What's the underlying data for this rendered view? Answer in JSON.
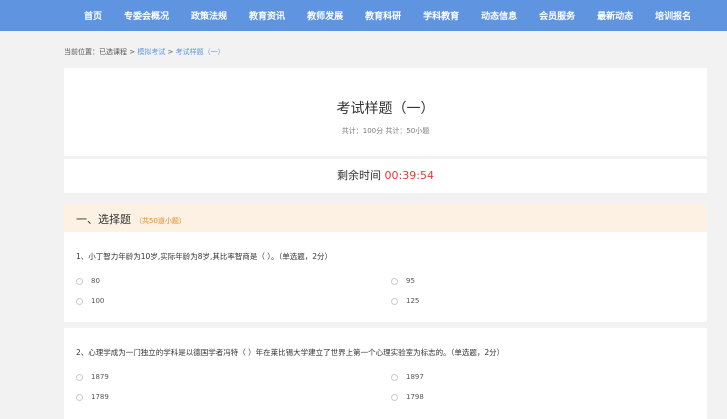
{
  "nav": {
    "items": [
      "首页",
      "专委会概况",
      "政策法规",
      "教育资讯",
      "教师发展",
      "教育科研",
      "学科教育",
      "动态信息",
      "会员服务",
      "最新动态",
      "培训报名"
    ]
  },
  "breadcrumb": {
    "prefix": "当前位置：",
    "items": [
      "已选课程",
      "模拟考试",
      "考试样题（一）"
    ],
    "separator": " > "
  },
  "exam": {
    "title": "考试样题（一）",
    "meta": "共计：100分 共计：50小题"
  },
  "timer": {
    "label": "剩余时间",
    "value": "00:39:54"
  },
  "section": {
    "title": "一、选择题",
    "count": "（共50道小题）"
  },
  "questions": [
    {
      "text": "1、小丁智力年龄为10岁,实际年龄为8岁,其比率智商是（ ）。（单选题，2分）",
      "options": [
        "80",
        "95",
        "100",
        "125"
      ]
    },
    {
      "text": "2、心理学成为一门独立的学科是以德国学者冯特（ ）年在莱比锡大学建立了世界上第一个心理实验室为标志的。（单选题，2分）",
      "options": [
        "1879",
        "1897",
        "1789",
        "1798"
      ]
    }
  ],
  "colors": {
    "nav_bg": "#5f95e0",
    "timer_value": "#e53935",
    "section_bg": "#fdf1e3",
    "section_count": "#e8872b"
  }
}
